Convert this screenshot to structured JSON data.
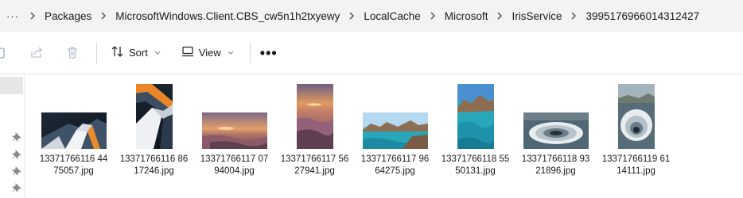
{
  "address_bar": {
    "overflow_label": "···",
    "breadcrumbs": [
      "Packages",
      "MicrosoftWindows.Client.CBS_cw5n1h2txyewy",
      "LocalCache",
      "Microsoft",
      "IrisService",
      "399517696601431242​7"
    ]
  },
  "command_bar": {
    "sort_label": "Sort",
    "view_label": "View",
    "more_label": "•••"
  },
  "files": [
    {
      "name_line1": "13371766116 44",
      "name_line2": "75057.jpg",
      "thumb": "abstract-architecture",
      "orientation": "landscape"
    },
    {
      "name_line1": "13371766116 86",
      "name_line2": "17246.jpg",
      "thumb": "abstract-architecture",
      "orientation": "portrait"
    },
    {
      "name_line1": "13371766117 07",
      "name_line2": "94004.jpg",
      "thumb": "sunset-shore",
      "orientation": "landscape"
    },
    {
      "name_line1": "13371766117 56",
      "name_line2": "27941.jpg",
      "thumb": "sunset-shore",
      "orientation": "portrait"
    },
    {
      "name_line1": "13371766117 96",
      "name_line2": "64275.jpg",
      "thumb": "turquoise-bay",
      "orientation": "landscape"
    },
    {
      "name_line1": "13371766118 55",
      "name_line2": "50131.jpg",
      "thumb": "turquoise-bay",
      "orientation": "portrait"
    },
    {
      "name_line1": "13371766118 93",
      "name_line2": "21896.jpg",
      "thumb": "dam-spillway",
      "orientation": "landscape"
    },
    {
      "name_line1": "13371766119 61",
      "name_line2": "14111.jpg",
      "thumb": "dam-spillway",
      "orientation": "portrait"
    }
  ]
}
